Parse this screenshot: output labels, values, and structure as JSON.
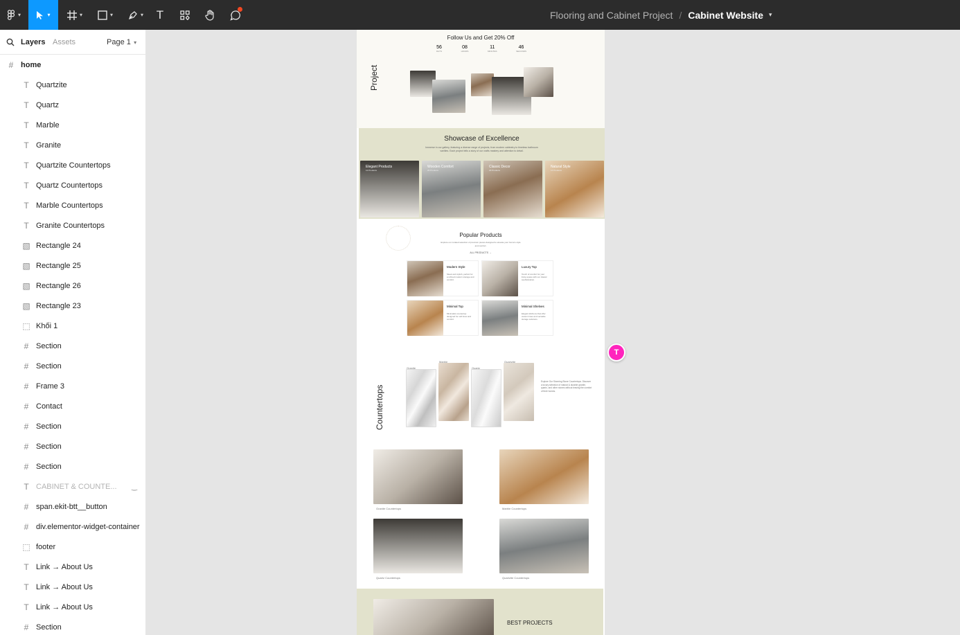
{
  "toolbar": {
    "tools": [
      {
        "name": "main-menu",
        "icon": "figma-logo-icon"
      },
      {
        "name": "move",
        "icon": "cursor-arrow-icon",
        "active": true
      },
      {
        "name": "frame",
        "icon": "frame-hash-icon"
      },
      {
        "name": "shape",
        "icon": "rectangle-icon"
      },
      {
        "name": "pen",
        "icon": "pen-icon"
      },
      {
        "name": "text",
        "icon": "text-icon",
        "glyph": "T"
      },
      {
        "name": "resources",
        "icon": "components-icon"
      },
      {
        "name": "hand",
        "icon": "hand-icon"
      },
      {
        "name": "comment",
        "icon": "comment-icon"
      }
    ],
    "project": "Flooring and Cabinet Project",
    "separator": "/",
    "file": "Cabinet Website",
    "accent": "#0d99ff"
  },
  "panel": {
    "tab_layers": "Layers",
    "tab_assets": "Assets",
    "page": "Page 1",
    "root": "home",
    "layers": [
      {
        "type": "text",
        "label": "Quartzite"
      },
      {
        "type": "text",
        "label": "Quartz"
      },
      {
        "type": "text",
        "label": "Marble"
      },
      {
        "type": "text",
        "label": "Granite"
      },
      {
        "type": "text",
        "label": "Quartzite Countertops"
      },
      {
        "type": "text",
        "label": "Quartz Countertops"
      },
      {
        "type": "text",
        "label": "Marble Countertops"
      },
      {
        "type": "text",
        "label": "Granite Countertops"
      },
      {
        "type": "image",
        "label": "Rectangle 24"
      },
      {
        "type": "image",
        "label": "Rectangle 25"
      },
      {
        "type": "image",
        "label": "Rectangle 26"
      },
      {
        "type": "image",
        "label": "Rectangle 23"
      },
      {
        "type": "group",
        "label": "Khối 1"
      },
      {
        "type": "frame",
        "label": "Section"
      },
      {
        "type": "frame",
        "label": "Section"
      },
      {
        "type": "frame",
        "label": "Frame 3"
      },
      {
        "type": "frame",
        "label": "Contact"
      },
      {
        "type": "frame",
        "label": "Section"
      },
      {
        "type": "frame",
        "label": "Section"
      },
      {
        "type": "frame",
        "label": "Section"
      },
      {
        "type": "text",
        "label": "CABINET & COUNTE...",
        "hidden": true
      },
      {
        "type": "frame",
        "label": "span.ekit-btt__button"
      },
      {
        "type": "frame",
        "label": "div.elementor-widget-container"
      },
      {
        "type": "group",
        "label": "footer"
      },
      {
        "type": "text",
        "label": "Link → About Us"
      },
      {
        "type": "text",
        "label": "Link → About Us"
      },
      {
        "type": "text",
        "label": "Link → About Us"
      },
      {
        "type": "frame",
        "label": "Section"
      }
    ]
  },
  "canvas": {
    "follow_title": "Follow Us and Get 20% Off",
    "countdown": [
      {
        "value": "56",
        "unit": "DAYS"
      },
      {
        "value": "08",
        "unit": "HOURS"
      },
      {
        "value": "11",
        "unit": "MINUTES"
      },
      {
        "value": "46",
        "unit": "SECONDS"
      }
    ],
    "project_label": "Project",
    "showcase_title": "Showcase of Excellence",
    "showcase_text": "Immerse in our gallery, featuring a diverse range of projects, from modern cabinetry to timeless bathroom vanities. Each project tells a story of our crafts mastery and attention to detail.",
    "showcase_cards": [
      {
        "title": "Elegant Products",
        "sub": "12 Products"
      },
      {
        "title": "Wooden Comfort",
        "sub": "26 Products"
      },
      {
        "title": "Classic Decor",
        "sub": "18 Products"
      },
      {
        "title": "Natural Style",
        "sub": "14 Products"
      }
    ],
    "popular_title": "Popular Products",
    "popular_text": "Explore our curated selection of premium pieces designed to elevate your home's style and comfort.",
    "popular_link": "ALL PRODUCTS →",
    "products": [
      {
        "title": "Modern Style",
        "desc": "Sleek and stylish, perfect for a refined modern storage and comfort."
      },
      {
        "title": "Luxury Top",
        "desc": "Touch of comfort for your living space with our classic sophistication."
      },
      {
        "title": "Minimal Top",
        "desc": "Minimalist countertop designed for soft lines and comfort."
      },
      {
        "title": "Minimal Shelves",
        "desc": "Elegant kitchens that offer custom lines and versatile storage solutions."
      }
    ],
    "countertops_label": "Countertops",
    "stone_labels": [
      "Granite",
      "Marble",
      "Quartz",
      "Quartzite"
    ],
    "countertops_text": "Explore Our Stunning Stone Countertops. Discover a luxury selection of natural & durable granite, quartz, and other stones without leaving the comfort of their homes.",
    "gallery_captions": [
      "Granite Countertops",
      "Marble Countertops",
      "Quartz Countertops",
      "Quartzite Countertops"
    ],
    "best_projects": "BEST PROJECTS",
    "beige": "#e2e2cc"
  },
  "collaborator": {
    "initial": "T",
    "color": "#ff24bd"
  }
}
